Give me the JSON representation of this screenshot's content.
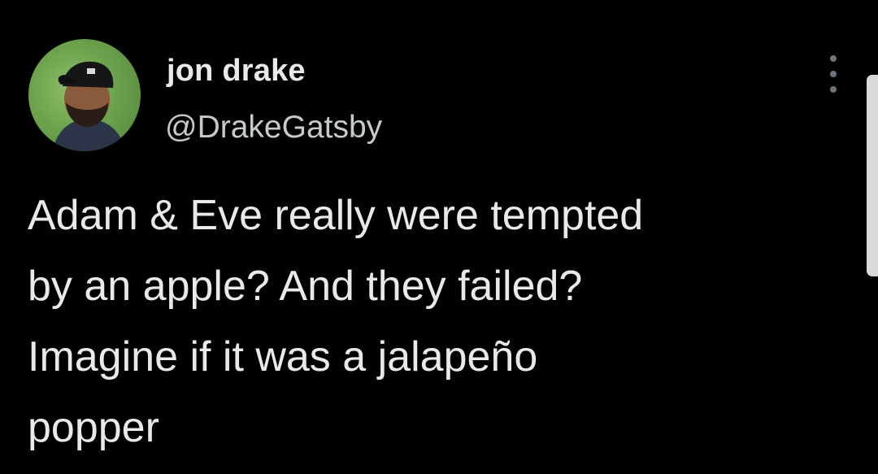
{
  "author": {
    "display_name": "jon drake",
    "handle": "@DrakeGatsby",
    "avatar_icon": "profile-photo"
  },
  "tweet": {
    "lines": [
      "Adam & Eve really were tempted",
      "by an apple? And they failed?",
      "Imagine if it was a jalapeño",
      "popper"
    ]
  },
  "menu": {
    "icon": "more-options-icon"
  },
  "colors": {
    "background": "#000000",
    "primary_text": "#e7e9ea",
    "secondary_text": "#c4c9cc",
    "icon_gray": "#6e767d",
    "scrollbar": "#d9d9d9"
  }
}
